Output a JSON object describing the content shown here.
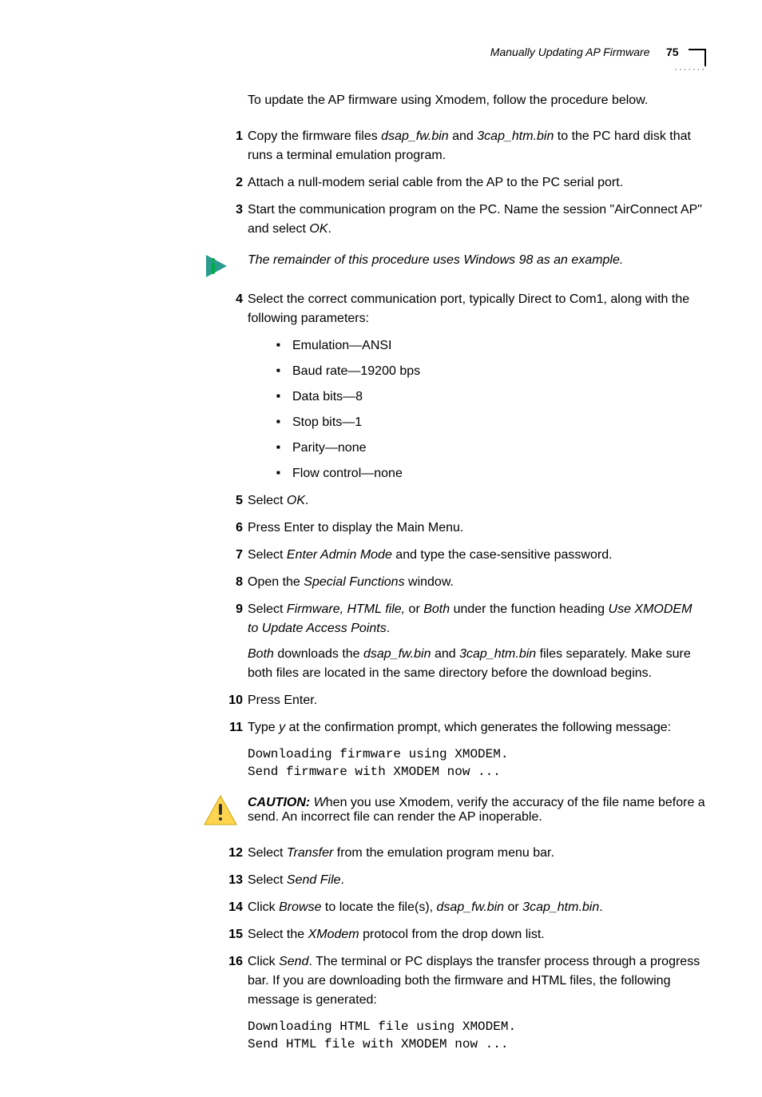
{
  "header": {
    "title": "Manually Updating AP Firmware",
    "page_number": "75"
  },
  "intro": "To update the AP firmware using Xmodem, follow the procedure below.",
  "steps": {
    "s1": {
      "num": "1",
      "pre": "Copy the firmware files ",
      "f1": "dsap_fw.bin",
      "mid": " and ",
      "f2": "3cap_htm.bin",
      "post": " to the PC hard disk that runs a terminal emulation program."
    },
    "s2": {
      "num": "2",
      "text": "Attach a null-modem serial cable from the AP to the PC serial port."
    },
    "s3": {
      "num": "3",
      "pre": "Start the communication program on the PC. Name the session \"AirConnect AP\" and select ",
      "ok": "OK",
      "post": "."
    },
    "note": "The remainder of this procedure uses Windows 98 as an example.",
    "s4": {
      "num": "4",
      "text": "Select the correct communication port, typically Direct to Com1, along with the following parameters:",
      "params": [
        "Emulation—ANSI",
        "Baud rate—19200 bps",
        "Data bits—8",
        "Stop bits—1",
        "Parity—none",
        "Flow control—none"
      ]
    },
    "s5": {
      "num": "5",
      "pre": "Select ",
      "ok": "OK",
      "post": "."
    },
    "s6": {
      "num": "6",
      "text": "Press Enter to display the Main Menu."
    },
    "s7": {
      "num": "7",
      "pre": "Select ",
      "it": "Enter Admin Mode",
      "post": " and type the case-sensitive password."
    },
    "s8": {
      "num": "8",
      "pre": "Open the ",
      "it": "Special Functions",
      "post": " window."
    },
    "s9": {
      "num": "9",
      "pre": "Select ",
      "it1": "Firmware, HTML file,",
      "mid1": " or ",
      "it2": "Both",
      "mid2": " under the function heading ",
      "it3": "Use XMODEM to Update Access Points",
      "post": ".",
      "extra_it1": "Both",
      "extra_t1": " downloads the ",
      "extra_it2": "dsap_fw.bin",
      "extra_t2": " and ",
      "extra_it3": "3cap_htm.bin",
      "extra_t3": " files separately. Make sure both files are located in the same directory before the download begins."
    },
    "s10": {
      "num": "10",
      "text": "Press Enter."
    },
    "s11": {
      "num": "11",
      "pre": "Type ",
      "it": "y",
      "post": " at the confirmation prompt, which generates the following message:",
      "code1": "Downloading firmware using XMODEM.",
      "code2": "Send firmware with XMODEM now ..."
    },
    "caution": {
      "label": "CAUTION: ",
      "w": "W",
      "text": "hen you use Xmodem, verify the accuracy of the file name before a send. An incorrect file can render the AP inoperable."
    },
    "s12": {
      "num": "12",
      "pre": "Select ",
      "it": "Transfer",
      "post": " from the emulation program menu bar."
    },
    "s13": {
      "num": "13",
      "pre": "Select ",
      "it": "Send File",
      "post": "."
    },
    "s14": {
      "num": "14",
      "pre": "Click ",
      "it1": "Browse",
      "mid1": " to locate the file(s), ",
      "it2": "dsap_fw.bin",
      "mid2": " or ",
      "it3": "3cap_htm.bin",
      "post": "."
    },
    "s15": {
      "num": "15",
      "pre": "Select the ",
      "it": "XModem",
      "post": " protocol from the drop down list."
    },
    "s16": {
      "num": "16",
      "pre": "Click ",
      "it": "Send",
      "post": ". The terminal or PC displays the transfer process through a progress bar. If you are downloading both the firmware and HTML files, the following message is generated:",
      "code1": "Downloading HTML file using XMODEM.",
      "code2": "Send HTML file with XMODEM now ..."
    }
  }
}
